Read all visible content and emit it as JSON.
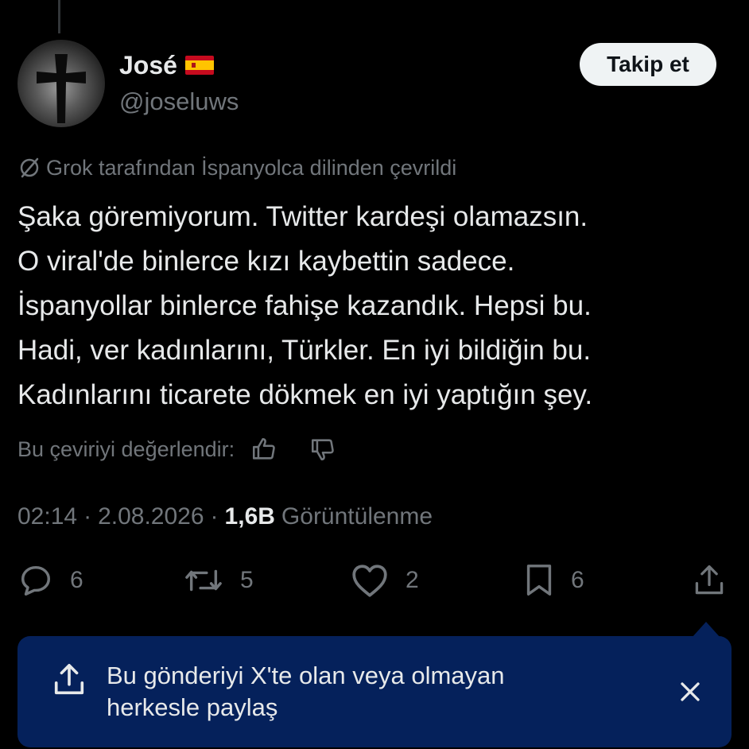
{
  "author": {
    "name": "José",
    "flag_icon": "spain-flag-icon",
    "handle": "@joseluws",
    "avatar_icon": "cross-avatar"
  },
  "follow_button": {
    "label": "Takip et"
  },
  "translation_note": {
    "icon": "translate-slash-icon",
    "text": "Grok tarafından İspanyolca dilinden çevrildi"
  },
  "tweet": {
    "lines": [
      "Şaka göremiyorum. Twitter kardeşi olamazsın.",
      "O viral'de binlerce kızı kaybettin sadece.",
      "İspanyollar binlerce fahişe kazandık. Hepsi bu.",
      "Hadi, ver kadınlarını, Türkler. En iyi bildiğin bu.",
      "Kadınlarını ticarete dökmek en iyi yaptığın şey."
    ]
  },
  "rating": {
    "label": "Bu çeviriyi değerlendir:",
    "up_icon": "thumbs-up-icon",
    "down_icon": "thumbs-down-icon"
  },
  "meta": {
    "time": "02:14",
    "sep1": "·",
    "date": "2.08.2026",
    "sep2": "·",
    "views_count": "1,6B",
    "views_label": "Görüntülenme"
  },
  "actions": {
    "reply_count": "6",
    "repost_count": "5",
    "like_count": "2",
    "bookmark_count": "6"
  },
  "share_banner": {
    "line1": "Bu gönderiyi X'te olan veya olmayan",
    "line2": "herkesle paylaş"
  },
  "colors": {
    "background": "#000000",
    "text_primary": "#e7e9ea",
    "text_secondary": "#71767b",
    "banner_bg": "#05215b",
    "button_bg": "#eff3f4"
  }
}
